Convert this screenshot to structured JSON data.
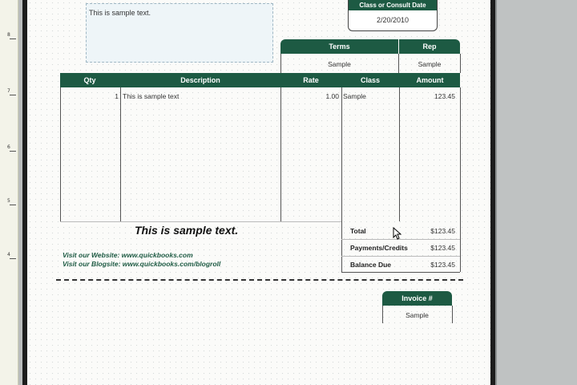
{
  "ruler": {
    "numbers": [
      "8",
      "7",
      "6",
      "5",
      "4"
    ]
  },
  "address_box": {
    "text": "This is sample text."
  },
  "date_box": {
    "header": "Class or Consult Date",
    "value": "2/20/2010"
  },
  "terms_header": {
    "terms": "Terms",
    "rep": "Rep",
    "terms_value": "Sample",
    "rep_value": "Sample"
  },
  "table": {
    "headers": [
      "Qty",
      "Description",
      "Rate",
      "Class",
      "Amount"
    ],
    "row": {
      "qty": "1",
      "description": "This is sample text",
      "rate": "1.00",
      "class": "Sample",
      "amount": "123.45"
    }
  },
  "note": "This is sample text.",
  "links": [
    "Visit our Website: www.quickbooks.com",
    "Visit our Blogsite: www.quickbooks.com/blogroll"
  ],
  "totals": [
    {
      "label": "Total",
      "value": "$123.45"
    },
    {
      "label": "Payments/Credits",
      "value": "$123.45"
    },
    {
      "label": "Balance Due",
      "value": "$123.45"
    }
  ],
  "invoice_box": {
    "header": "Invoice #",
    "value": "Sample"
  },
  "colors": {
    "accent": "#1d5a43"
  }
}
